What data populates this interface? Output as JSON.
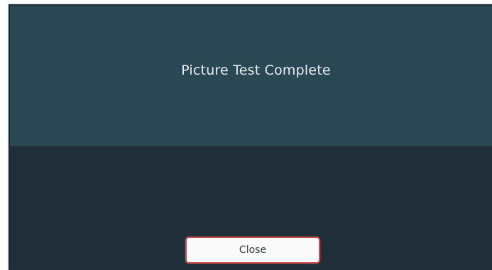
{
  "dialog": {
    "title": "Picture Test Complete",
    "close_label": "Close"
  },
  "colors": {
    "header_background": "#294854",
    "body_background": "#1f2e38",
    "button_border": "#d34a4a"
  }
}
